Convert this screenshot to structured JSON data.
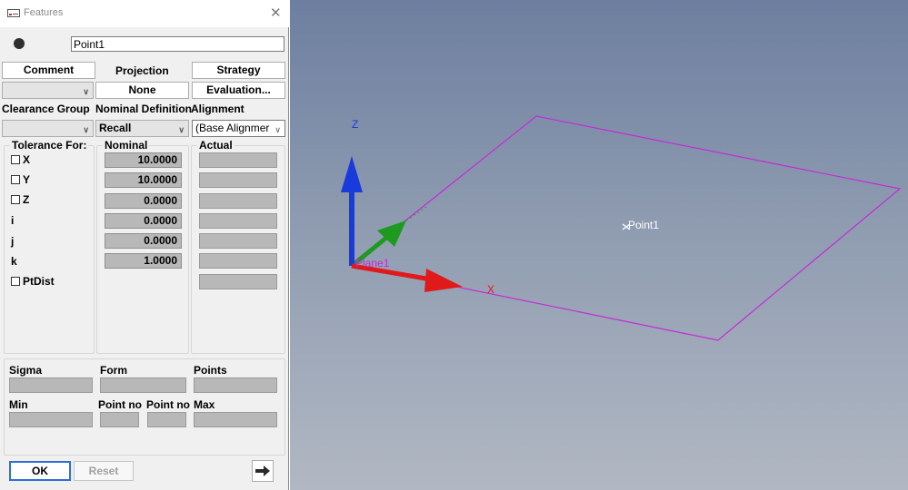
{
  "window": {
    "title": "Features",
    "close_glyph": "✕"
  },
  "feature": {
    "name": "Point1"
  },
  "buttons": {
    "comment": "Comment",
    "strategy": "Strategy",
    "evaluation": "Evaluation...",
    "ok": "OK",
    "reset": "Reset",
    "arrow_icon": "right-arrow-icon"
  },
  "labels": {
    "projection": "Projection",
    "projection_value": "None",
    "clearance_group": "Clearance Group",
    "nominal_definition": "Nominal Definition",
    "alignment": "Alignment",
    "tolerance_for": "Tolerance For:",
    "nominal": "Nominal",
    "actual": "Actual"
  },
  "combos": {
    "comment_combo": "",
    "clearance_group": "",
    "nominal_definition": "Recall",
    "alignment": "(Base Alignmer"
  },
  "tolerance_rows": [
    {
      "label": "X",
      "checkbox": true,
      "nominal": "10.0000"
    },
    {
      "label": "Y",
      "checkbox": true,
      "nominal": "10.0000"
    },
    {
      "label": "Z",
      "checkbox": true,
      "nominal": "0.0000"
    },
    {
      "label": "i",
      "checkbox": false,
      "nominal": "0.0000"
    },
    {
      "label": "j",
      "checkbox": false,
      "nominal": "0.0000"
    },
    {
      "label": "k",
      "checkbox": false,
      "nominal": "1.0000"
    },
    {
      "label": "PtDist",
      "checkbox": true,
      "nominal": ""
    }
  ],
  "stats": {
    "sigma": "Sigma",
    "form": "Form",
    "points": "Points",
    "min": "Min",
    "point_no_1": "Point no",
    "point_no_2": "Point no",
    "max": "Max"
  },
  "viewport": {
    "axis_z": "Z",
    "axis_x": "X",
    "plane_label": "Plane1",
    "point_label": "Point1",
    "colors": {
      "z_axis": "#1a3bdc",
      "x_axis": "#e01a1a",
      "y_axis": "#1e9a1e",
      "plane": "#c42bd6",
      "point": "#e8f4ff"
    }
  }
}
